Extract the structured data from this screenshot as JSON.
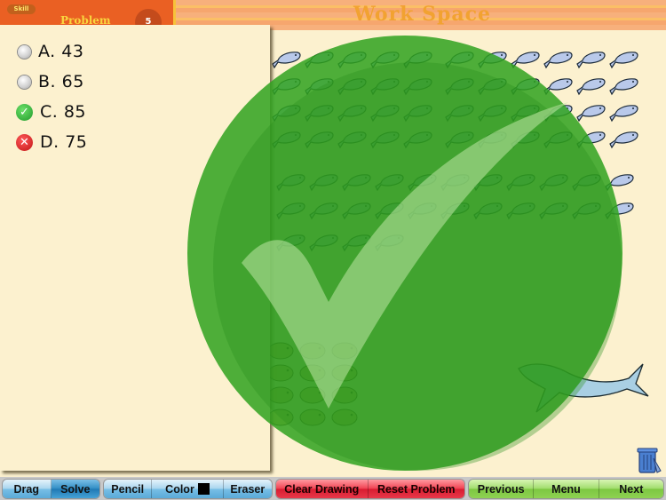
{
  "header": {
    "skill_label": "Skill",
    "problem_label": "Problem",
    "problem_number": "5",
    "workspace_title": "Work Space"
  },
  "answers": {
    "choices": [
      {
        "letter": "A.",
        "value": "43",
        "label": "A. 43",
        "state": "unselected"
      },
      {
        "letter": "B.",
        "value": "65",
        "label": "B. 65",
        "state": "unselected"
      },
      {
        "letter": "C.",
        "value": "85",
        "label": "C. 85",
        "state": "correct"
      },
      {
        "letter": "D.",
        "value": "75",
        "label": "D. 75",
        "state": "incorrect"
      }
    ],
    "correct_icon": "checkmark-icon",
    "incorrect_icon": "x-icon"
  },
  "feedback": {
    "result": "correct",
    "icon": "big-checkmark-icon",
    "color": "#2fa21f"
  },
  "workspace": {
    "items": [
      "fish",
      "hammerhead-shark",
      "pufferfish"
    ],
    "trash_icon": "trash-can-icon"
  },
  "toolbar": {
    "drag": "Drag",
    "solve": "Solve",
    "pencil": "Pencil",
    "color": "Color",
    "current_color": "#000000",
    "eraser": "Eraser",
    "clear_drawing": "Clear Drawing",
    "reset_problem": "Reset Problem",
    "previous": "Previous",
    "menu": "Menu",
    "next": "Next"
  },
  "colors": {
    "header_orange": "#ea6023",
    "panel_bg": "#fcf1cf",
    "tool_blue": "#5aaad8",
    "tool_red": "#d81c30",
    "tool_green": "#7cc741"
  }
}
